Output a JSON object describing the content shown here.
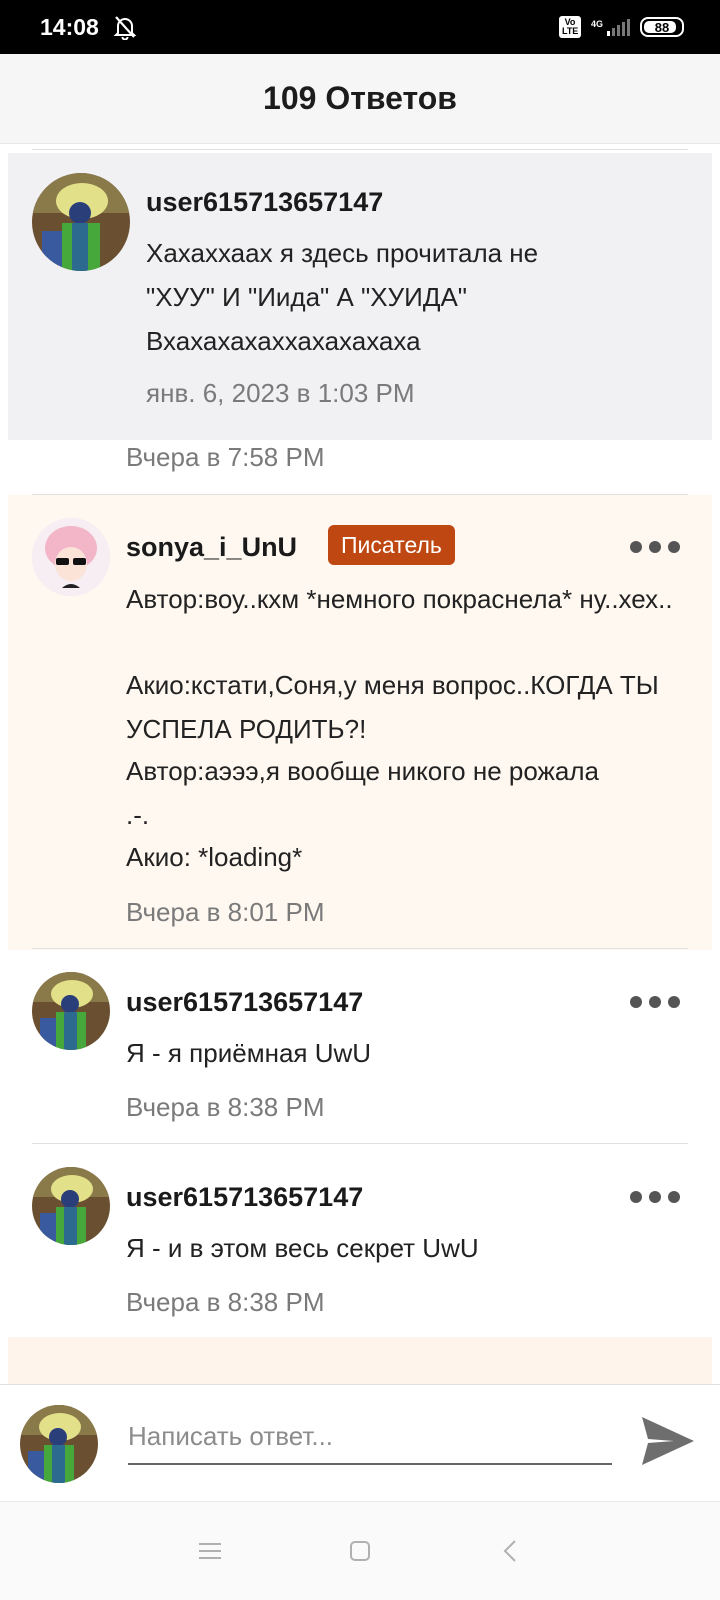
{
  "status_bar": {
    "time": "14:08",
    "icons": [
      "bell-off-icon",
      "volte-icon",
      "signal-icon",
      "battery-icon"
    ],
    "volte_label": "Vo LTE",
    "network_label": "4G",
    "battery_level": "88"
  },
  "header": {
    "title": "109 Ответов"
  },
  "comments": [
    {
      "username": "user615713657147",
      "text": "Хахаххаах я здесь прочитала не \"ХУУ\" И \"Иида\" А \"ХУИДА\" Вхахахахаххахахахаха",
      "timestamp": "янв. 6, 2023 в 1:03 PM",
      "reply_timestamp": "Вчера в 7:58 PM"
    },
    {
      "username": "sonya_i_UnU",
      "badge": "Писатель",
      "lines": [
        "Автор:воу..кхм *немного покраснела* ну..хех..",
        "Акио:кстати,Соня,у меня вопрос..КОГДА ТЫ УСПЕЛА РОДИТЬ?!",
        "Автор:аэээ,я вообще никого не рожала .-.",
        "Акио: *loading*"
      ],
      "timestamp": "Вчера в 8:01 PM"
    },
    {
      "username": "user615713657147",
      "text": "Я - я приёмная UwU",
      "timestamp": "Вчера в 8:38 PM"
    },
    {
      "username": "user615713657147",
      "text": "Я - и в этом весь секрет UwU",
      "timestamp": "Вчера в 8:38 PM"
    }
  ],
  "composer": {
    "placeholder": "Написать ответ..."
  },
  "colors": {
    "badge": "#bf4712",
    "writer_bg": "#fff8f1",
    "quote_bg": "#f1f1f4"
  }
}
